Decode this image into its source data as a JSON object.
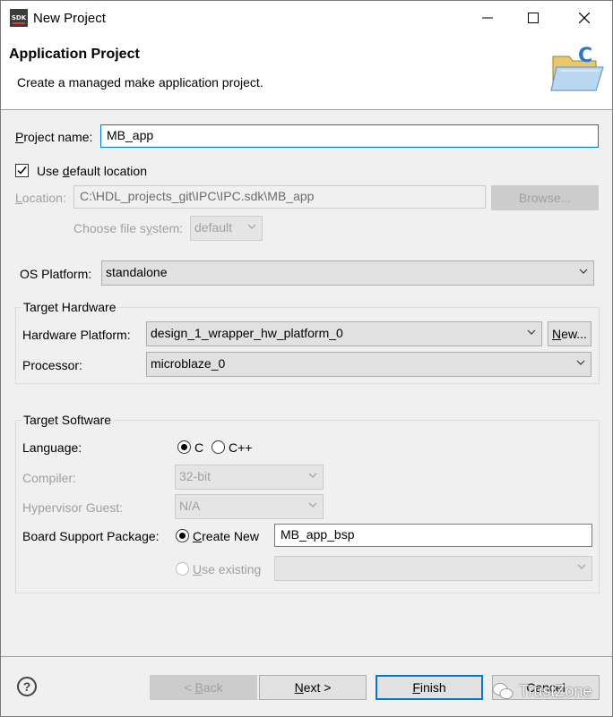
{
  "window": {
    "icon_text": "SDK",
    "title": "New Project",
    "minimize_glyph": "—",
    "maximize_glyph": "☐",
    "close_glyph": "✕"
  },
  "header": {
    "title": "Application Project",
    "description": "Create a managed make application project.",
    "icon": "folder-c-icon"
  },
  "project": {
    "name_label_prefix": "P",
    "name_label_rest": "roject name:",
    "name_value": "MB_app",
    "use_default_prefix": "Use ",
    "use_default_mnemonic": "d",
    "use_default_rest": "efault location",
    "use_default_checked": true,
    "location_label_prefix": "L",
    "location_label_rest": "ocation:",
    "location_value": "C:\\HDL_projects_git\\IPC\\IPC.sdk\\MB_app",
    "browse_prefix": "Browse...",
    "fs_label_prefix": "Choose file s",
    "fs_label_mnemonic": "y",
    "fs_label_rest": "stem:",
    "fs_value": "default"
  },
  "os": {
    "label": "OS Platform:",
    "value": "standalone"
  },
  "target_hardware": {
    "title": "Target Hardware",
    "platform_label": "Hardware Platform:",
    "platform_value": "design_1_wrapper_hw_platform_0",
    "new_button_mnemonic": "N",
    "new_button_rest": "ew...",
    "processor_label": "Processor:",
    "processor_value": "microblaze_0"
  },
  "target_software": {
    "title": "Target Software",
    "language_label": "Language:",
    "lang_c": "C",
    "lang_cpp": "C++",
    "lang_selected": "C",
    "compiler_label": "Compiler:",
    "compiler_value": "32-bit",
    "hypervisor_label": "Hypervisor Guest:",
    "hypervisor_value": "N/A",
    "bsp_label": "Board Support Package:",
    "create_new_mnemonic": "C",
    "create_new_rest": "reate New",
    "bsp_name": "MB_app_bsp",
    "use_existing_mnemonic": "U",
    "use_existing_rest": "se existing"
  },
  "footer": {
    "help_glyph": "?",
    "back_prefix": "< ",
    "back_mnemonic": "B",
    "back_rest": "ack",
    "next_mnemonic": "N",
    "next_rest": "ext >",
    "finish_mnemonic": "F",
    "finish_rest": "inish",
    "cancel_label": "Cancel",
    "watermark_text": "TrustZone"
  },
  "colors": {
    "accent": "#0078d7",
    "window_bg": "#f0f0f0",
    "disabled_text": "#a0a0a0"
  }
}
